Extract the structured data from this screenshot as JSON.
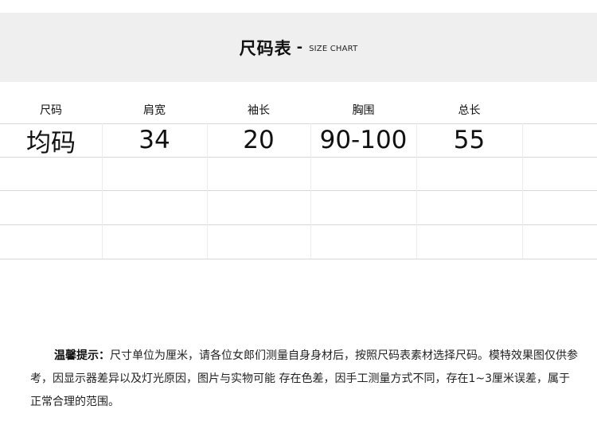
{
  "header": {
    "title": "尺码表",
    "dash": "-",
    "subtitle": "SIZE CHART"
  },
  "table": {
    "columns": [
      "尺码",
      "肩宽",
      "袖长",
      "胸围",
      "总长",
      ""
    ],
    "rows": [
      [
        "均码",
        "34",
        "20",
        "90-100",
        "55",
        ""
      ]
    ]
  },
  "note": {
    "label": "温馨提示：",
    "text": "尺寸单位为厘米，请各位女郎们测量自身身材后，按照尺码表素材选择尺码。模特效果图仅供参考，因显示器差异以及灯光原因，图片与实物可能 存在色差，因手工测量方式不同，存在1~3厘米误差，属于正常合理的范围。"
  }
}
